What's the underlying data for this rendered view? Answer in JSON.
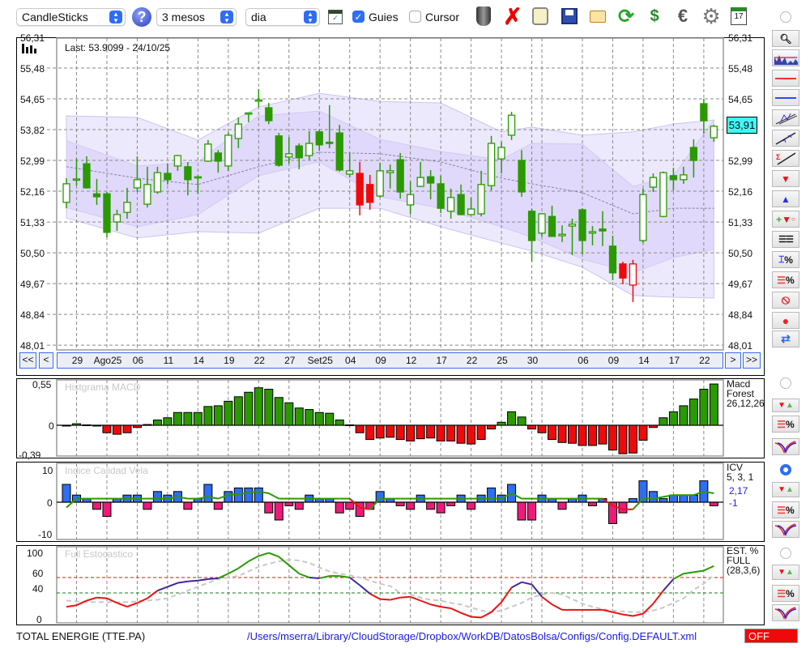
{
  "toolbar": {
    "chart_type": "CandleSticks",
    "period": "3 mesos",
    "interval": "dia",
    "guides_label": "Guies",
    "guides_checked": true,
    "cursor_label": "Cursor",
    "cursor_checked": false,
    "calendar_day": "17",
    "icons": [
      "help-icon",
      "chart-window-icon",
      "trash-icon",
      "delete-icon",
      "lamp-icon",
      "save-icon",
      "folder-icon",
      "refresh-icon",
      "recycle-money-icon",
      "euro-icon",
      "gear-icon",
      "calendar-icon"
    ]
  },
  "main": {
    "last_label": "Last: 53.9099 - 24/10/25",
    "last_price_tag": "53,91",
    "y_labels": [
      "56,31",
      "55,48",
      "54,65",
      "53,82",
      "52,99",
      "52,16",
      "51,33",
      "50,50",
      "49,67",
      "48,84",
      "48,01"
    ],
    "nav": {
      "first": "<<",
      "prev": "<",
      "next": ">",
      "last": ">>"
    },
    "date_ticks": [
      {
        "i": 2,
        "label": "29"
      },
      {
        "i": 5,
        "label": "Ago25"
      },
      {
        "i": 8,
        "label": "06"
      },
      {
        "i": 11,
        "label": "11"
      },
      {
        "i": 14,
        "label": "14"
      },
      {
        "i": 17,
        "label": "19"
      },
      {
        "i": 20,
        "label": "22"
      },
      {
        "i": 23,
        "label": "27"
      },
      {
        "i": 26,
        "label": "Set25"
      },
      {
        "i": 29,
        "label": "04"
      },
      {
        "i": 32,
        "label": "09"
      },
      {
        "i": 35,
        "label": "12"
      },
      {
        "i": 38,
        "label": "17"
      },
      {
        "i": 41,
        "label": "22"
      },
      {
        "i": 44,
        "label": "25"
      },
      {
        "i": 47,
        "label": "30"
      },
      {
        "i": 48,
        "label": ""
      },
      {
        "i": 52,
        "label": "06"
      },
      {
        "i": 55,
        "label": "09"
      },
      {
        "i": 58,
        "label": "14"
      },
      {
        "i": 61,
        "label": "17"
      },
      {
        "i": 64,
        "label": "22"
      }
    ]
  },
  "chart_data": {
    "type": "candlestick",
    "ylim": [
      48.01,
      56.31
    ],
    "colors": {
      "up": "#2a9a00",
      "alt": "#ee0a0a",
      "band_outer": "#ece9fd",
      "band_inner": "#e0d9fb"
    },
    "red_candles": [
      30,
      31,
      56,
      57
    ],
    "ohlc": [
      [
        51.86,
        52.51,
        51.7,
        52.36
      ],
      [
        52.47,
        53.04,
        52.31,
        52.49
      ],
      [
        52.9,
        53.1,
        52.23,
        52.25
      ],
      [
        52.09,
        52.49,
        51.79,
        52.01
      ],
      [
        52.09,
        52.14,
        50.92,
        51.05
      ],
      [
        51.33,
        51.66,
        51.09,
        51.53
      ],
      [
        51.59,
        52.25,
        51.42,
        51.86
      ],
      [
        52.25,
        53.1,
        52.14,
        52.47
      ],
      [
        51.81,
        52.82,
        51.72,
        52.34
      ],
      [
        52.14,
        52.82,
        52.09,
        52.66
      ],
      [
        52.64,
        52.9,
        52.34,
        52.47
      ],
      [
        52.84,
        53.14,
        52.71,
        53.12
      ],
      [
        52.82,
        52.95,
        52.05,
        52.47
      ],
      [
        52.53,
        52.58,
        52.09,
        52.55
      ],
      [
        52.97,
        53.54,
        52.95,
        53.43
      ],
      [
        53.19,
        53.27,
        52.66,
        52.97
      ],
      [
        52.84,
        53.75,
        52.71,
        53.67
      ],
      [
        53.58,
        54.15,
        53.32,
        53.97
      ],
      [
        54.25,
        54.28,
        54.02,
        54.27
      ],
      [
        54.6,
        54.91,
        54.43,
        54.62
      ],
      [
        54.41,
        54.54,
        53.97,
        54.06
      ],
      [
        53.65,
        53.73,
        52.82,
        52.86
      ],
      [
        53.08,
        53.62,
        52.9,
        53.17
      ],
      [
        53.38,
        53.45,
        52.75,
        53.06
      ],
      [
        53.12,
        53.78,
        53.01,
        53.45
      ],
      [
        53.76,
        53.82,
        53.25,
        53.41
      ],
      [
        53.48,
        54.48,
        53.32,
        53.47
      ],
      [
        53.73,
        53.95,
        52.69,
        52.73
      ],
      [
        52.62,
        53.19,
        52.53,
        52.71
      ],
      [
        52.64,
        52.95,
        51.51,
        51.79
      ],
      [
        52.34,
        52.6,
        51.66,
        51.86
      ],
      [
        52.03,
        52.93,
        51.99,
        52.71
      ],
      [
        52.66,
        52.88,
        52.23,
        52.71
      ],
      [
        53.01,
        53.19,
        51.96,
        52.14
      ],
      [
        51.79,
        52.42,
        51.55,
        52.07
      ],
      [
        52.29,
        52.95,
        52.27,
        52.53
      ],
      [
        52.55,
        52.73,
        51.94,
        52.38
      ],
      [
        52.36,
        52.58,
        51.57,
        51.7
      ],
      [
        51.62,
        52.23,
        51.42,
        51.99
      ],
      [
        52.07,
        52.34,
        51.51,
        51.53
      ],
      [
        51.53,
        51.99,
        51.51,
        51.68
      ],
      [
        51.55,
        52.71,
        51.48,
        52.34
      ],
      [
        52.31,
        53.65,
        52.18,
        53.45
      ],
      [
        53.03,
        53.49,
        52.64,
        53.34
      ],
      [
        53.67,
        54.3,
        53.54,
        54.21
      ],
      [
        52.99,
        53.27,
        52.01,
        52.14
      ],
      [
        51.62,
        51.68,
        50.26,
        50.83
      ],
      [
        51.03,
        51.57,
        50.94,
        51.55
      ],
      [
        51.48,
        51.77,
        50.93,
        50.94
      ],
      [
        50.96,
        51.24,
        50.79,
        51.0
      ],
      [
        51.22,
        51.42,
        50.44,
        51.27
      ],
      [
        51.66,
        51.7,
        50.46,
        50.83
      ],
      [
        51.03,
        51.22,
        50.7,
        51.07
      ],
      [
        51.14,
        51.62,
        50.68,
        51.09
      ],
      [
        50.68,
        50.96,
        49.76,
        49.96
      ],
      [
        50.2,
        50.26,
        49.65,
        49.82
      ],
      [
        49.63,
        50.31,
        49.17,
        50.2
      ],
      [
        50.83,
        52.23,
        50.76,
        52.07
      ],
      [
        52.27,
        52.64,
        52.14,
        52.53
      ],
      [
        51.48,
        52.69,
        51.46,
        52.66
      ],
      [
        52.58,
        52.79,
        52.18,
        52.47
      ],
      [
        52.47,
        52.82,
        52.36,
        52.6
      ],
      [
        53.34,
        53.56,
        52.53,
        52.99
      ],
      [
        54.52,
        54.65,
        53.71,
        54.06
      ],
      [
        53.6,
        53.95,
        53.49,
        53.91
      ]
    ],
    "bands": {
      "at": [
        1,
        8,
        14,
        20,
        26,
        32,
        38,
        44,
        47,
        52,
        57,
        61,
        65
      ],
      "outer_upper": [
        54.19,
        54.15,
        53.54,
        54.43,
        54.8,
        54.58,
        54.54,
        53.76,
        53.89,
        53.67,
        53.76,
        53.97,
        54.08
      ],
      "inner_upper": [
        53.52,
        52.84,
        52.95,
        54.19,
        54.32,
        53.56,
        53.23,
        53.01,
        53.45,
        53.43,
        52.29,
        52.58,
        54.08
      ],
      "mid": [
        52.82,
        52.51,
        52.34,
        52.82,
        53.21,
        53.17,
        52.95,
        52.51,
        52.36,
        52.12,
        51.55,
        51.7,
        51.7
      ],
      "inner_lower": [
        51.72,
        51.2,
        51.53,
        52.58,
        52.95,
        52.01,
        51.7,
        51.2,
        50.92,
        50.33,
        49.96,
        50.37,
        50.59
      ],
      "outer_lower": [
        51.44,
        50.9,
        51.07,
        51.03,
        51.7,
        51.7,
        51.2,
        50.76,
        50.55,
        50.11,
        49.35,
        49.3,
        49.28
      ]
    },
    "macd": {
      "title": "Histgrama MACD",
      "y_labels": [
        "0,55",
        "0",
        "-0,39"
      ],
      "ylim": [
        -0.39,
        0.55
      ],
      "side": [
        "Macd",
        "Forest",
        "26,12,26"
      ],
      "values": [
        0,
        0.02,
        0.005,
        0,
        -0.1,
        -0.12,
        -0.1,
        -0.03,
        0.01,
        0.07,
        0.1,
        0.17,
        0.17,
        0.17,
        0.25,
        0.26,
        0.32,
        0.38,
        0.44,
        0.5,
        0.48,
        0.37,
        0.3,
        0.23,
        0.21,
        0.17,
        0.16,
        0.07,
        0.005,
        -0.1,
        -0.19,
        -0.17,
        -0.16,
        -0.19,
        -0.21,
        -0.18,
        -0.17,
        -0.21,
        -0.21,
        -0.24,
        -0.25,
        -0.19,
        -0.05,
        0.04,
        0.18,
        0.11,
        -0.05,
        -0.1,
        -0.19,
        -0.23,
        -0.24,
        -0.27,
        -0.27,
        -0.25,
        -0.33,
        -0.38,
        -0.37,
        -0.2,
        -0.03,
        0.1,
        0.18,
        0.26,
        0.35,
        0.48,
        0.55
      ]
    },
    "icv": {
      "title": "Indice Calidad Vela",
      "y_labels": [
        "10",
        "0",
        "-10"
      ],
      "ylim": [
        -10,
        10
      ],
      "side": [
        "ICV",
        "5, 3, 1"
      ],
      "values_label": [
        "2,17",
        "-1"
      ],
      "bars": [
        5,
        2,
        1,
        -2,
        -4,
        1,
        2,
        2,
        -2,
        3,
        2,
        3,
        -2,
        1,
        5,
        -2,
        3,
        4,
        4,
        4,
        -3,
        -5,
        -1,
        -2,
        2,
        1,
        1,
        -3,
        -2,
        -4,
        -2,
        3,
        1,
        -1,
        -2,
        2,
        -2,
        -3,
        -1,
        2,
        -2,
        2,
        4,
        2,
        5,
        -5,
        -5,
        2,
        1,
        -2,
        1,
        2,
        -1,
        1,
        -6,
        -3,
        1,
        6,
        3,
        1,
        2,
        2,
        2,
        6,
        -1
      ],
      "line": [
        -1.5,
        1,
        1,
        1,
        1,
        1,
        1,
        1,
        1,
        1,
        1,
        1.5,
        1,
        1,
        1.5,
        1,
        2,
        2.3,
        2.6,
        3,
        2.5,
        1,
        1,
        1,
        1,
        1,
        1,
        1,
        1,
        -1.5,
        -2,
        1,
        1,
        1,
        1,
        1,
        1,
        1,
        1,
        1,
        1,
        1,
        1,
        1,
        2.5,
        1,
        1,
        1,
        1,
        1,
        1,
        1,
        1,
        1,
        -1,
        -2,
        -2,
        1,
        1,
        1.5,
        2,
        2,
        2,
        3,
        2.5
      ]
    },
    "stoch": {
      "title": "Full Estocastico",
      "y_labels": [
        "100",
        "60",
        "40",
        "0"
      ],
      "levels": [
        60,
        40
      ],
      "side": [
        "EST. %",
        "FULL",
        "(28,3,6)"
      ],
      "k": [
        22,
        24,
        30,
        34,
        33,
        27,
        22,
        27,
        33,
        43,
        48,
        53,
        55,
        56,
        58,
        59,
        65,
        72,
        81,
        88,
        92,
        87,
        76,
        65,
        60,
        59,
        62,
        62,
        60,
        50,
        39,
        32,
        31,
        34,
        35,
        30,
        25,
        22,
        20,
        14,
        9,
        8,
        15,
        28,
        47,
        54,
        51,
        35,
        25,
        18,
        18,
        18,
        18,
        18,
        15,
        12,
        10,
        13,
        26,
        43,
        58,
        65,
        67,
        69,
        75
      ],
      "d": [
        30,
        29,
        28,
        28,
        28,
        28,
        28,
        29,
        30,
        31,
        33,
        38,
        43,
        48,
        53,
        58,
        60,
        62,
        68,
        74,
        78,
        81,
        83,
        82,
        79,
        73,
        68,
        65,
        63,
        60,
        56,
        52,
        49,
        40,
        38,
        34,
        31,
        30,
        27,
        25,
        21,
        17,
        15,
        17,
        22,
        27,
        34,
        38,
        40,
        38,
        32,
        26,
        22,
        19,
        17,
        16,
        15,
        15,
        17,
        21,
        27,
        33,
        44,
        52,
        63
      ]
    }
  },
  "status": {
    "instrument": "TOTAL ENERGIE (TTE.PA)",
    "config_path": "/Users/mserra/Library/CloudStorage/Dropbox/WorkDB/DatosBolsa/Configs/Config.DEFAULT.xml",
    "off_label": "OFF"
  }
}
